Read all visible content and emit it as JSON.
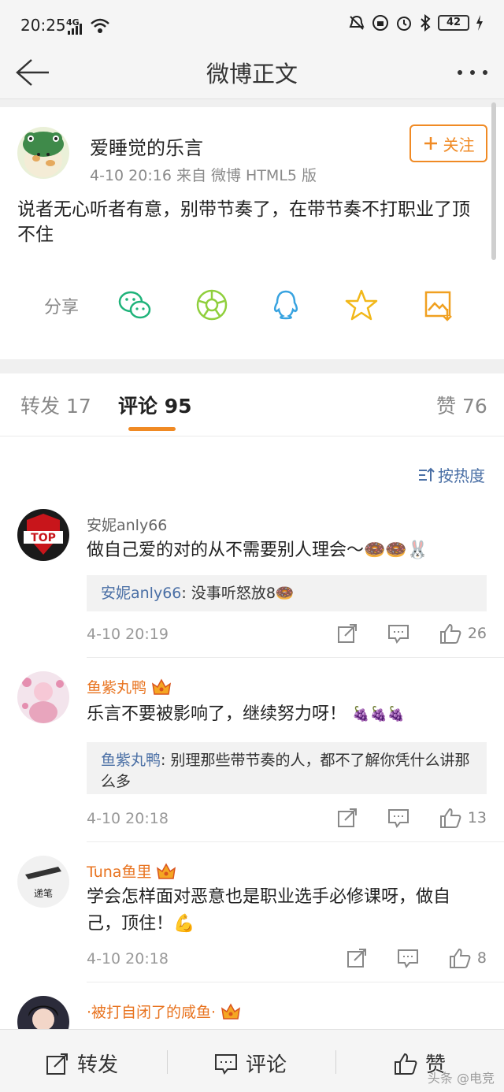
{
  "status_bar": {
    "time": "20:25",
    "network": "4G",
    "battery": "42"
  },
  "nav": {
    "title": "微博正文"
  },
  "post": {
    "author": "爱睡觉的乐言",
    "meta": "4-10 20:16   来自 微博 HTML5 版",
    "follow_label": "关注",
    "text": "说者无心听者有意，别带节奏了，在带节奏不打职业了顶不住",
    "share_label": "分享",
    "share_icons": [
      "wechat-icon",
      "moments-icon",
      "qq-icon",
      "qzone-icon",
      "save-image-icon"
    ]
  },
  "tabs": [
    {
      "label": "转发 17"
    },
    {
      "label": "评论 95",
      "active": true
    },
    {
      "label": "赞 76"
    }
  ],
  "sort_label": "按热度",
  "comments": [
    {
      "name": "安妮anly66",
      "text": "做自己爱的对的从不需要别人理会〜🍩🍩🐰",
      "reply_name": "安妮anly66",
      "reply_text": ": 没事听怒放8🍩",
      "time": "4-10 20:19",
      "likes": "26"
    },
    {
      "name": "鱼紫丸鸭",
      "text": "乐言不要被影响了，继续努力呀！",
      "emoji": [
        "🍇",
        "🍇",
        "🍇"
      ],
      "reply_name": "鱼紫丸鸭",
      "reply_text": ": 别理那些带节奏的人，都不了解你凭什么讲那么多",
      "time": "4-10 20:18",
      "likes": "13"
    },
    {
      "name": "Tuna鱼里",
      "text": "学会怎样面对恶意也是职业选手必修课呀，做自己，顶住！💪",
      "time": "4-10 20:18",
      "likes": "8"
    },
    {
      "name": "·被打自闭了的咸鱼·"
    }
  ],
  "avatar_texts": {
    "top_team": "TOP",
    "pen": "递笔"
  },
  "bottom_bar": {
    "repost": "转发",
    "comment": "评论",
    "like": "赞"
  },
  "watermark": "头条 @电竞",
  "colors": {
    "accent": "#f08a24",
    "link": "#4a6fa5",
    "background": "#f5f5f5"
  }
}
